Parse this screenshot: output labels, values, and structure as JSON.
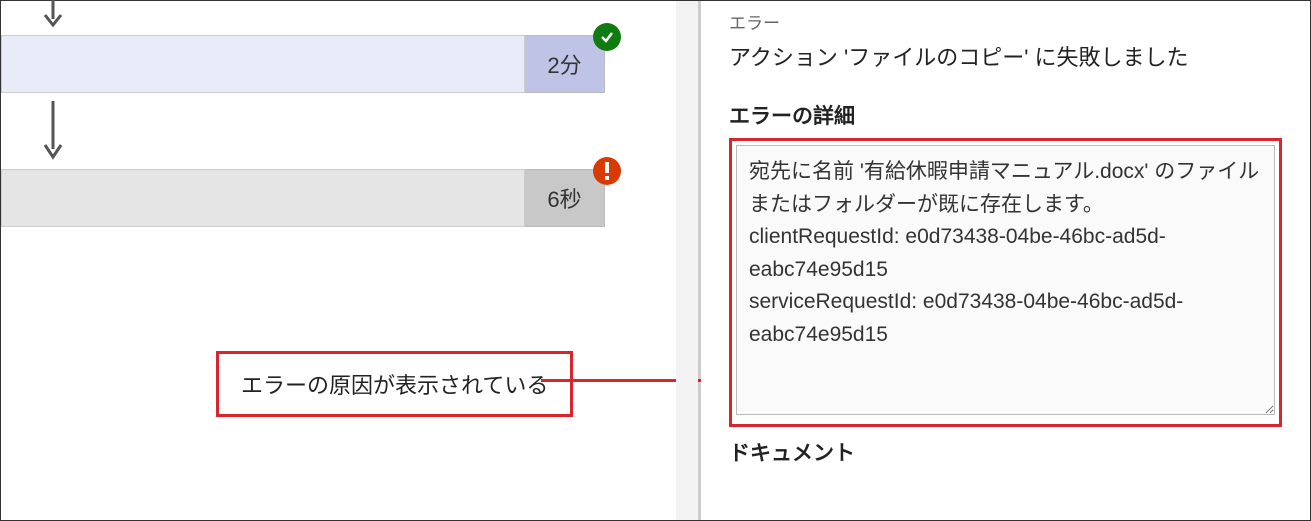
{
  "flow": {
    "steps": [
      {
        "duration": "2分",
        "status": "success"
      },
      {
        "duration": "6秒",
        "status": "error"
      }
    ]
  },
  "callout": {
    "text": "エラーの原因が表示されている"
  },
  "panel": {
    "error_label": "エラー",
    "error_message": "アクション 'ファイルのコピー' に失敗しました",
    "details_title": "エラーの詳細",
    "details_body": "宛先に名前 '有給休暇申請マニュアル.docx' のファイルまたはフォルダーが既に存在します。\nclientRequestId: e0d73438-04be-46bc-ad5d-eabc74e95d15\nserviceRequestId: e0d73438-04be-46bc-ad5d-eabc74e95d15",
    "document_title": "ドキュメント"
  }
}
